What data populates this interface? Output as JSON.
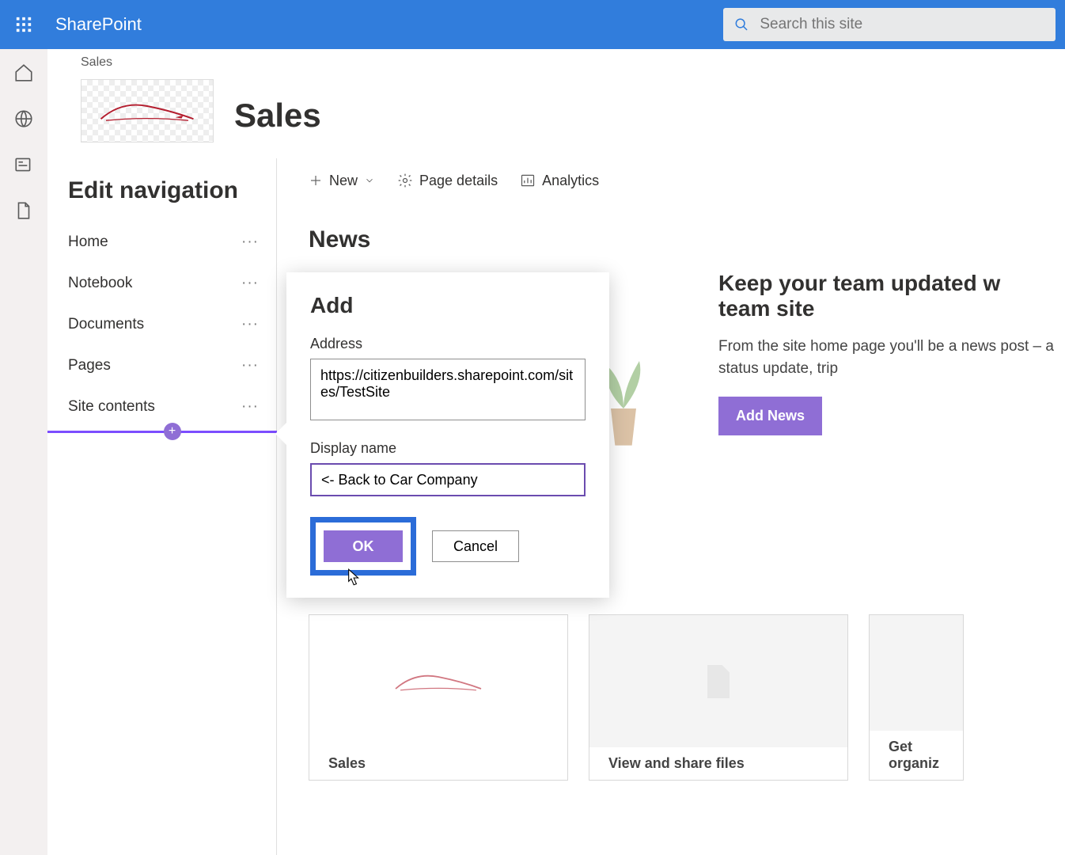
{
  "topbar": {
    "app_name": "SharePoint",
    "search_placeholder": "Search this site"
  },
  "site": {
    "breadcrumb": "Sales",
    "title": "Sales"
  },
  "nav": {
    "panel_title": "Edit navigation",
    "items": [
      {
        "label": "Home"
      },
      {
        "label": "Notebook"
      },
      {
        "label": "Documents"
      },
      {
        "label": "Pages"
      },
      {
        "label": "Site contents"
      }
    ]
  },
  "cmdbar": {
    "new": "New",
    "page_details": "Page details",
    "analytics": "Analytics"
  },
  "news": {
    "heading": "News",
    "promo_title": "Keep your team updated w",
    "promo_title_line2": "team site",
    "promo_body": "From the site home page you'll be a news post – a status update, trip ",
    "add_button": "Add News"
  },
  "dialog": {
    "title": "Add",
    "address_label": "Address",
    "address_value": "https://citizenbuilders.sharepoint.com/sites/TestSite",
    "display_label": "Display name",
    "display_value": "<- Back to Car Company",
    "ok": "OK",
    "cancel": "Cancel"
  },
  "cards": [
    {
      "label": "Sales"
    },
    {
      "label": "View and share files"
    },
    {
      "label": "Get organiz"
    }
  ],
  "colors": {
    "brand_blue": "#317ddc",
    "accent_purple": "#8f6ed5",
    "highlight_blue": "#2b6cd8"
  }
}
